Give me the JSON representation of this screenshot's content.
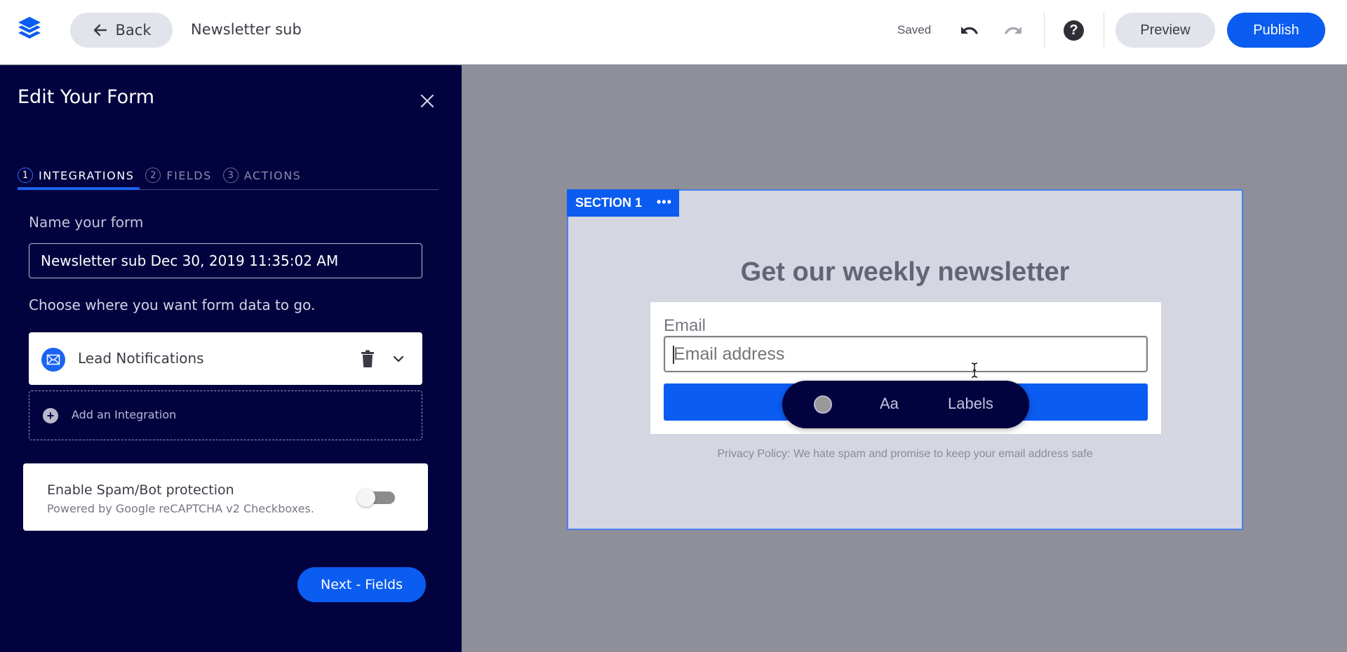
{
  "topbar": {
    "logo_icon": "layers-icon",
    "back_label": "Back",
    "doc_title": "Newsletter sub",
    "status": "Saved",
    "undo_icon": "undo-icon",
    "redo_icon": "redo-icon",
    "help_icon": "help-icon",
    "help_glyph": "?",
    "preview_label": "Preview",
    "publish_label": "Publish"
  },
  "sidebar": {
    "title": "Edit Your Form",
    "close_icon": "close-icon",
    "steps": [
      {
        "num": "1",
        "label": "INTEGRATIONS",
        "active": true
      },
      {
        "num": "2",
        "label": "FIELDS",
        "active": false
      },
      {
        "num": "3",
        "label": "ACTIONS",
        "active": false
      }
    ],
    "name_label": "Name your form",
    "name_value": "Newsletter sub Dec 30, 2019 11:35:02 AM",
    "choose_label": "Choose where you want form data to go.",
    "integrations": [
      {
        "name": "Lead Notifications",
        "icon": "mail-icon"
      }
    ],
    "add_integration_label": "Add an Integration",
    "add_glyph": "+",
    "spam": {
      "title": "Enable Spam/Bot protection",
      "subtitle": "Powered by Google reCAPTCHA v2 Checkboxes.",
      "enabled": false
    },
    "next_label": "Next - Fields"
  },
  "canvas": {
    "section_label": "SECTION 1",
    "section_menu_glyph": "•••",
    "headline": "Get our weekly newsletter",
    "email_label": "Email",
    "email_placeholder": "Email address",
    "toolbar": {
      "color_icon": "color-swatch-icon",
      "font_label": "Aa",
      "labels_label": "Labels"
    },
    "privacy_text": "Privacy Policy: We hate spam and promise to keep your email address safe"
  },
  "colors": {
    "brand_blue": "#0b5cf0",
    "sidebar_bg": "#02023f",
    "canvas_bg": "#8e8f99",
    "section_bg": "#d4d6e2"
  }
}
